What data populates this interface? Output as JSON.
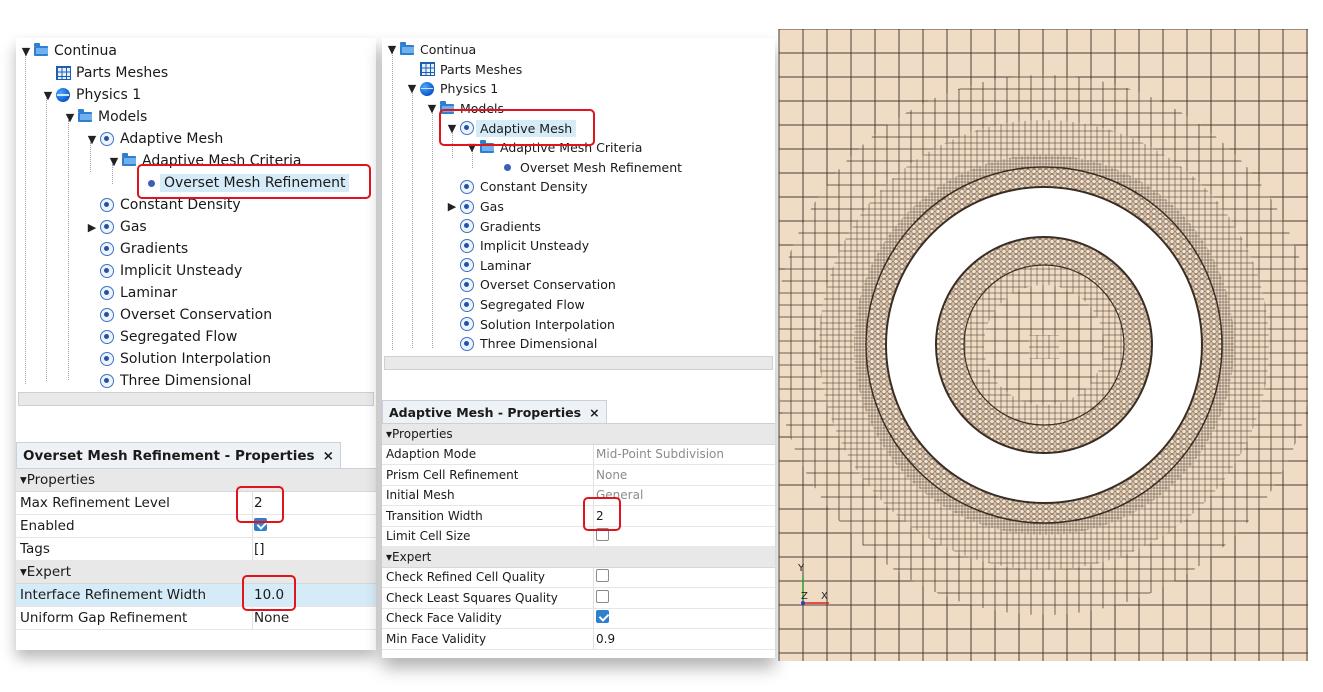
{
  "left_tree": {
    "continua": "Continua",
    "parts_meshes": "Parts Meshes",
    "physics": "Physics 1",
    "models": "Models",
    "adaptive_mesh": "Adaptive Mesh",
    "adaptive_mesh_criteria": "Adaptive Mesh Criteria",
    "overset_mesh_refinement": "Overset Mesh Refinement",
    "model_items": [
      "Constant Density",
      "Gas",
      "Gradients",
      "Implicit Unsteady",
      "Laminar",
      "Overset Conservation",
      "Segregated Flow",
      "Solution Interpolation",
      "Three Dimensional"
    ]
  },
  "left_props": {
    "tab_title": "Overset Mesh Refinement - Properties",
    "close": "×",
    "section_properties": "Properties",
    "section_expert": "Expert",
    "rows": [
      {
        "name": "Max Refinement Level",
        "value": "2"
      },
      {
        "name": "Enabled",
        "value": ""
      },
      {
        "name": "Tags",
        "value": "[]"
      }
    ],
    "expert_rows": [
      {
        "name": "Interface Refinement Width",
        "value": "10.0"
      },
      {
        "name": "Uniform Gap Refinement",
        "value": "None"
      }
    ]
  },
  "mid_tree": {
    "continua": "Continua",
    "parts_meshes": "Parts Meshes",
    "physics": "Physics 1",
    "models": "Models",
    "adaptive_mesh": "Adaptive Mesh",
    "adaptive_mesh_criteria": "Adaptive Mesh Criteria",
    "overset_mesh_refinement": "Overset Mesh Refinement",
    "model_items": [
      "Constant Density",
      "Gas",
      "Gradients",
      "Implicit Unsteady",
      "Laminar",
      "Overset Conservation",
      "Segregated Flow",
      "Solution Interpolation",
      "Three Dimensional"
    ]
  },
  "mid_props": {
    "tab_title": "Adaptive Mesh - Properties",
    "close": "×",
    "section_properties": "Properties",
    "section_expert": "Expert",
    "rows": [
      {
        "name": "Adaption Mode",
        "value": "Mid-Point Subdivision"
      },
      {
        "name": "Prism Cell Refinement",
        "value": "None"
      },
      {
        "name": "Initial Mesh",
        "value": "General"
      },
      {
        "name": "Transition Width",
        "value": "2"
      },
      {
        "name": "Limit Cell Size",
        "value": ""
      }
    ],
    "expert_rows": [
      {
        "name": "Check Refined Cell Quality",
        "value": ""
      },
      {
        "name": "Check Least Squares Quality",
        "value": ""
      },
      {
        "name": "Check Face Validity",
        "value": ""
      },
      {
        "name": "Min Face Validity",
        "value": "0.9"
      }
    ]
  },
  "mesh_view": {
    "axis_y": "Y",
    "axis_x": "X",
    "axis_z": "Z",
    "cell_color": "#f0dbc4",
    "line_color": "#3a2e24"
  },
  "colors": {
    "highlight": "#d6ebf8",
    "callout": "#e0141b",
    "accent": "#2f7fd0"
  }
}
